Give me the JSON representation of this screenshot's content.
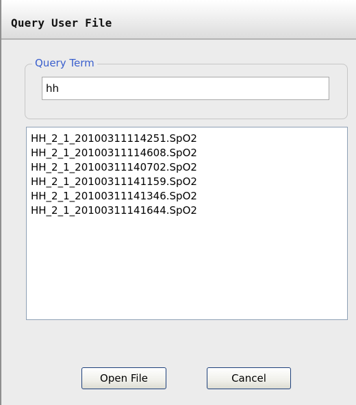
{
  "window": {
    "title": "Query User File"
  },
  "query": {
    "group_label": "Query Term",
    "value": "hh"
  },
  "results": {
    "items": [
      "HH_2_1_20100311114251.SpO2",
      "HH_2_1_20100311114608.SpO2",
      "HH_2_1_20100311140702.SpO2",
      "HH_2_1_20100311141159.SpO2",
      "HH_2_1_20100311141346.SpO2",
      "HH_2_1_20100311141644.SpO2"
    ]
  },
  "buttons": {
    "open_label": "Open File",
    "cancel_label": "Cancel"
  }
}
